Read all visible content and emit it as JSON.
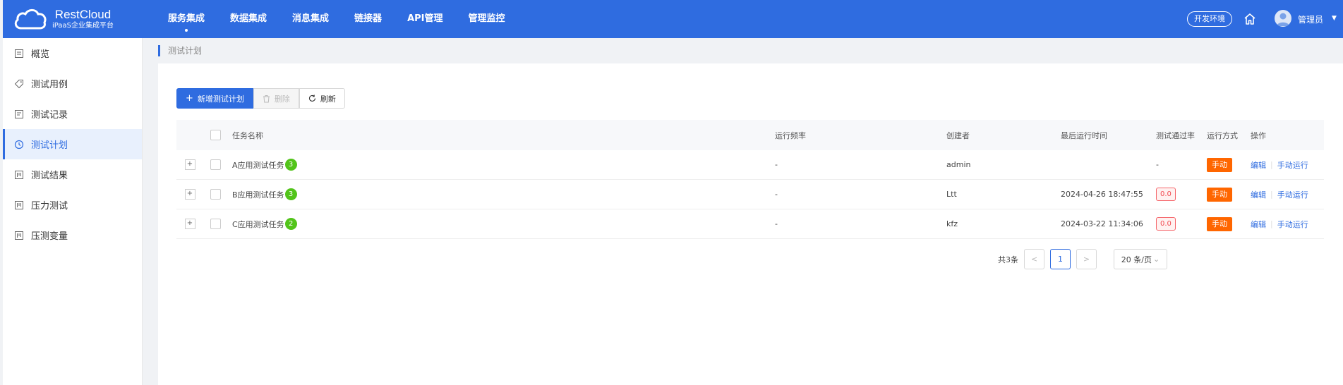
{
  "header": {
    "logo_title": "RestCloud",
    "logo_subtitle": "iPaaS企业集成平台",
    "nav": [
      "服务集成",
      "数据集成",
      "消息集成",
      "链接器",
      "API管理",
      "管理监控"
    ],
    "env_label": "开发环境",
    "user_name": "管理员",
    "user_caret": "▼",
    "brand_color": "#2f6ce0"
  },
  "sidebar": {
    "items": [
      {
        "label": "概览",
        "icon": "overview-icon"
      },
      {
        "label": "测试用例",
        "icon": "tag-icon"
      },
      {
        "label": "测试记录",
        "icon": "record-icon"
      },
      {
        "label": "测试计划",
        "icon": "clock-icon",
        "active": true
      },
      {
        "label": "测试结果",
        "icon": "result-icon"
      },
      {
        "label": "压力测试",
        "icon": "pressure-icon"
      },
      {
        "label": "压测变量",
        "icon": "variable-icon"
      }
    ]
  },
  "breadcrumb": "测试计划",
  "toolbar": {
    "add_icon": "+",
    "add_label": "新增测试计划",
    "delete_label": "删除",
    "refresh_label": "刷新"
  },
  "table": {
    "columns": [
      "任务名称",
      "运行频率",
      "创建者",
      "最后运行时间",
      "测试通过率",
      "运行方式",
      "操作"
    ],
    "rows": [
      {
        "name": "A应用测试任务",
        "count": "3",
        "freq": "-",
        "creator": "admin",
        "last_run": "",
        "rate": "-",
        "mode": "手动",
        "edit": "编辑",
        "run": "手动运行"
      },
      {
        "name": "B应用测试任务",
        "count": "3",
        "freq": "-",
        "creator": "Ltt",
        "last_run": "2024-04-26 18:47:55",
        "rate": "0.0",
        "mode": "手动",
        "edit": "编辑",
        "run": "手动运行"
      },
      {
        "name": "C应用测试任务",
        "count": "2",
        "freq": "-",
        "creator": "kfz",
        "last_run": "2024-03-22 11:34:06",
        "rate": "0.0",
        "mode": "手动",
        "edit": "编辑",
        "run": "手动运行"
      }
    ]
  },
  "pagination": {
    "total": "共3条",
    "prev": "<",
    "current": "1",
    "next": ">",
    "page_size": "20 条/页"
  }
}
